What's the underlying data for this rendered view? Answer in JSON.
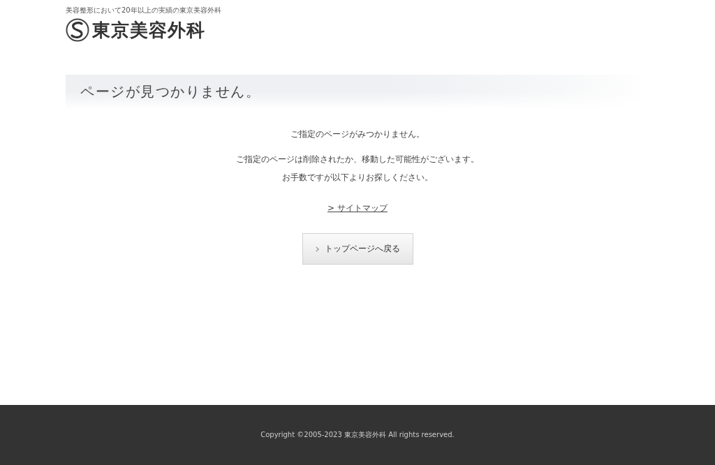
{
  "header": {
    "tagline": "美容整形において20年以上の実績の東京美容外科",
    "logo_text": "東京美容外科"
  },
  "page_heading": "ページが見つかりません。",
  "message_groups": [
    [
      "ご指定のページがみつかりません。"
    ],
    [
      "ご指定のページは削除されたか、移動した可能性がございます。",
      "お手数ですが以下よりお探しください。"
    ]
  ],
  "sitemap_link": "> サイトマップ",
  "back_button": "トップページへ戻る",
  "footer": {
    "copyright": "Copyright ©2005-2023 東京美容外科 All rights reserved."
  }
}
